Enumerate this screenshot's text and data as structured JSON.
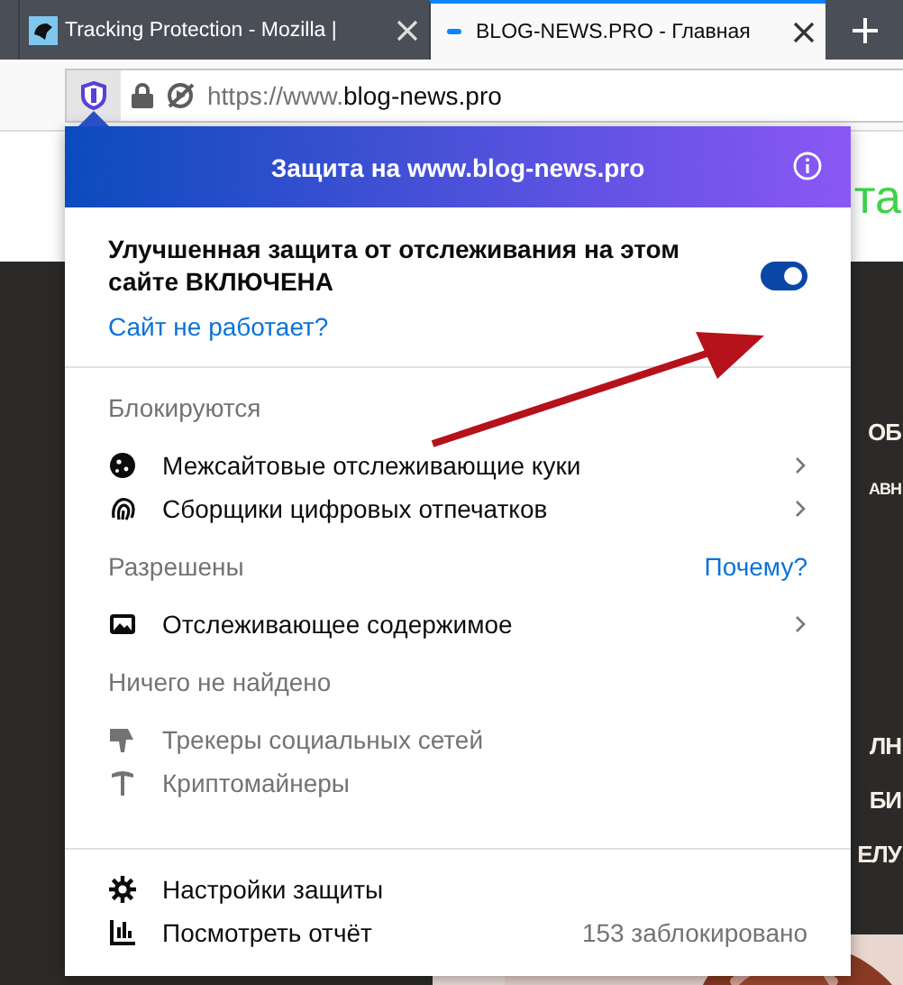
{
  "tabs": [
    {
      "title": "Tracking Protection - Mozilla |",
      "selected": false
    },
    {
      "title": "BLOG-NEWS.PRO - Главная",
      "selected": true
    }
  ],
  "address": {
    "prefix": "https://www.",
    "domain": "blog-news.pro"
  },
  "page": {
    "headline": "та",
    "fragments": [
      "ОБ",
      "АВН",
      "ЛН",
      "БИ",
      "ЕЛУ"
    ]
  },
  "panel": {
    "title": "Защита на www.blog-news.pro",
    "status": "Улучшенная защита от отслеживания на этом сайте ВКЛЮЧЕНА",
    "enabled": true,
    "broken_link": "Сайт не работает?",
    "sections": [
      {
        "heading": "Блокируются",
        "items": [
          {
            "kind": "cookies",
            "label": "Межсайтовые отслеживающие куки",
            "expandable": true,
            "disabled": false
          },
          {
            "kind": "fingerprinters",
            "label": "Сборщики цифровых отпечатков",
            "expandable": true,
            "disabled": false
          }
        ]
      },
      {
        "heading": "Разрешены",
        "link": "Почему?",
        "items": [
          {
            "kind": "content",
            "label": "Отслеживающее содержимое",
            "expandable": true,
            "disabled": false
          }
        ]
      },
      {
        "heading": "Ничего не найдено",
        "items": [
          {
            "kind": "social",
            "label": "Трекеры социальных сетей",
            "expandable": false,
            "disabled": true
          },
          {
            "kind": "cryptominers",
            "label": "Криптомайнеры",
            "expandable": false,
            "disabled": true
          }
        ]
      }
    ],
    "footer": [
      {
        "kind": "settings",
        "label": "Настройки защиты"
      },
      {
        "kind": "report",
        "label": "Посмотреть отчёт",
        "note": "153 заблокировано"
      }
    ]
  }
}
